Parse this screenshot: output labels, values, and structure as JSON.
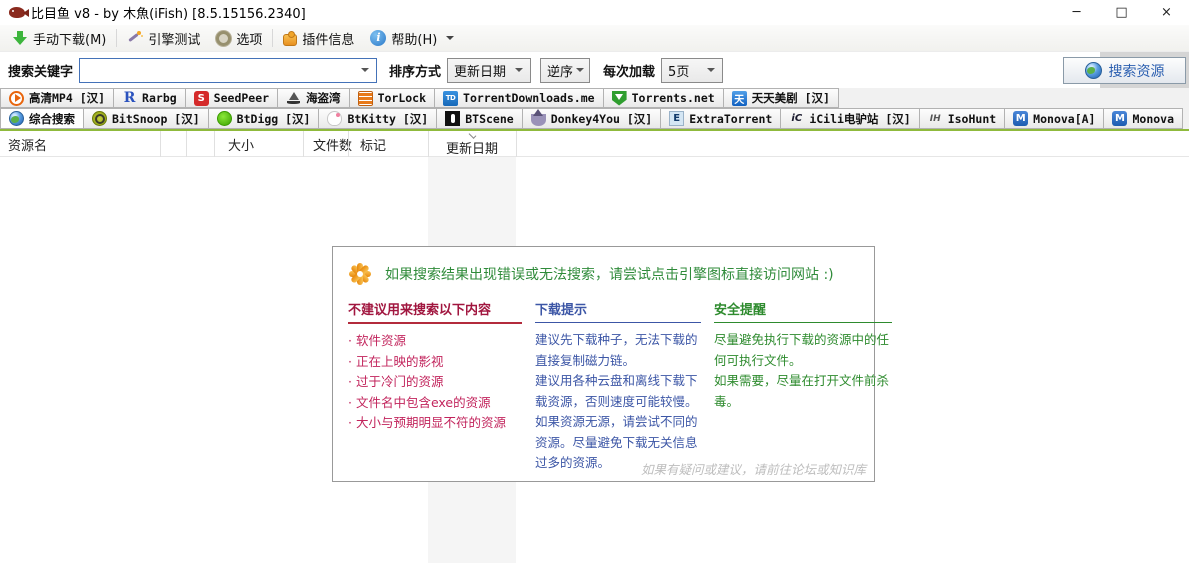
{
  "window": {
    "title": "比目鱼 v8 - by 木魚(iFish) [8.5.15156.2340]"
  },
  "titlebar": {
    "minimize": "─",
    "maximize": "□",
    "close": "×"
  },
  "toolbar": {
    "items": [
      {
        "label": "手动下载(M)"
      },
      {
        "label": "引擎测试"
      },
      {
        "label": "选项"
      },
      {
        "label": "插件信息"
      },
      {
        "label": "帮助(H)",
        "icon_text": "i"
      }
    ]
  },
  "search": {
    "keyword_label": "搜索关键字",
    "keyword_value": "",
    "sort_label": "排序方式",
    "sort_value": "更新日期",
    "order_value": "逆序",
    "load_label": "每次加载",
    "load_value": "5页",
    "button_label": "搜索资源"
  },
  "engines": {
    "row1": [
      {
        "label": "高清MP4 [汉]"
      },
      {
        "label": "Rarbg",
        "icon_text": "R"
      },
      {
        "label": "SeedPeer",
        "icon_text": "S"
      },
      {
        "label": "海盗湾"
      },
      {
        "label": "TorLock"
      },
      {
        "label": "TorrentDownloads.me",
        "icon_text": "TD"
      },
      {
        "label": "Torrents.net"
      },
      {
        "label": "天天美剧 [汉]",
        "icon_text": "天"
      }
    ],
    "row2": [
      {
        "label": "综合搜索"
      },
      {
        "label": "BitSnoop [汉]"
      },
      {
        "label": "BtDigg [汉]"
      },
      {
        "label": "BtKitty [汉]"
      },
      {
        "label": "BTScene"
      },
      {
        "label": "Donkey4You [汉]"
      },
      {
        "label": "ExtraTorrent",
        "icon_text": "E"
      },
      {
        "label": "iCili电驴站 [汉]",
        "icon_text": "iC"
      },
      {
        "label": "IsoHunt",
        "icon_text": "IH"
      },
      {
        "label": "Monova[A]",
        "icon_text": "M"
      },
      {
        "label": "Monova",
        "icon_text": "M"
      }
    ]
  },
  "table": {
    "columns": [
      "资源名",
      "",
      "",
      "大小",
      "文件数",
      "标记",
      "更新日期"
    ]
  },
  "dialog": {
    "header": "如果搜索结果出现错误或无法搜索，请尝试点击引擎图标直接访问网站 :)",
    "col1": {
      "title": "不建议用来搜索以下内容",
      "items": [
        "· 软件资源",
        "· 正在上映的影视",
        "· 过于冷门的资源",
        "· 文件名中包含exe的资源",
        "· 大小与预期明显不符的资源"
      ]
    },
    "col2": {
      "title": "下载提示",
      "lines": [
        "建议先下载种子，无法下载的直接复制磁力链。",
        "建议用各种云盘和离线下载下载资源，否则速度可能较慢。",
        "如果资源无源，请尝试不同的资源。尽量避免下载无关信息过多的资源。"
      ]
    },
    "col3": {
      "title": "安全提醒",
      "lines": [
        "尽量避免执行下载的资源中的任何可执行文件。",
        "如果需要，尽量在打开文件前杀毒。"
      ]
    },
    "footer": "如果有疑问或建议，请前往论坛或知识库"
  },
  "colors": {
    "tab_underline_green": "#8fba3c",
    "dialog_header_green": "#2f8b3a",
    "warn_red": "#c2245c",
    "tip_blue": "#3c56a6",
    "safe_green": "#2e8b2e",
    "search_button_text": "#2b5fb0",
    "keyword_box_border": "#4472b8"
  }
}
